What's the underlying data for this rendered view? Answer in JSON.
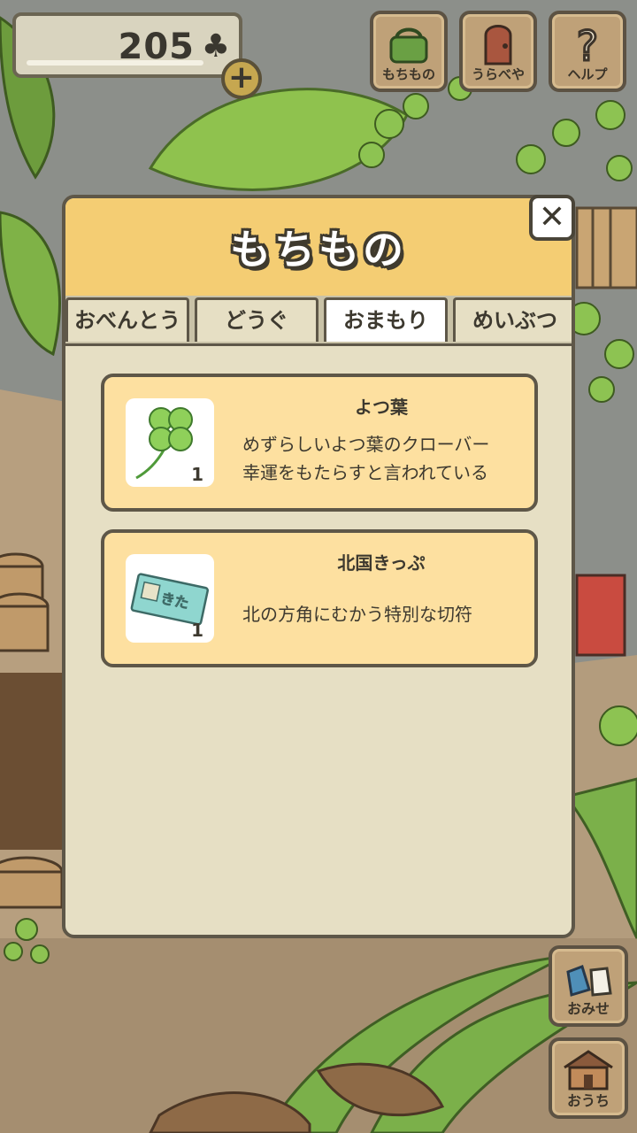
{
  "hud": {
    "clover_count": "205",
    "clover_symbol": "♣",
    "add_symbol": "+",
    "buttons": [
      {
        "label": "もちもの",
        "icon": "bag-icon"
      },
      {
        "label": "うらべや",
        "icon": "door-icon"
      },
      {
        "label": "ヘルプ",
        "icon": "help-icon"
      }
    ]
  },
  "modal": {
    "title": "もちもの",
    "close_symbol": "✕",
    "tabs": [
      {
        "label": "おべんとう",
        "active": false
      },
      {
        "label": "どうぐ",
        "active": false
      },
      {
        "label": "おまもり",
        "active": true
      },
      {
        "label": "めいぶつ",
        "active": false
      }
    ],
    "items": [
      {
        "name": "よつ葉",
        "quantity": "1",
        "icon": "four-leaf-clover-icon",
        "desc_line1": "めずらしいよつ葉のクローバー",
        "desc_line2": "幸運をもたらすと言われている"
      },
      {
        "name": "北国きっぷ",
        "quantity": "1",
        "icon": "ticket-icon",
        "ticket_text": "きた",
        "desc_line1": "北の方角にむかう特別な切符"
      }
    ]
  },
  "side_buttons": [
    {
      "label": "おみせ",
      "icon": "shop-bags-icon"
    },
    {
      "label": "おうち",
      "icon": "house-icon"
    }
  ],
  "colors": {
    "modal_header": "#f4cd73",
    "modal_body": "#e6dfc4",
    "card": "#fde0a0",
    "outline": "#5e5748"
  }
}
